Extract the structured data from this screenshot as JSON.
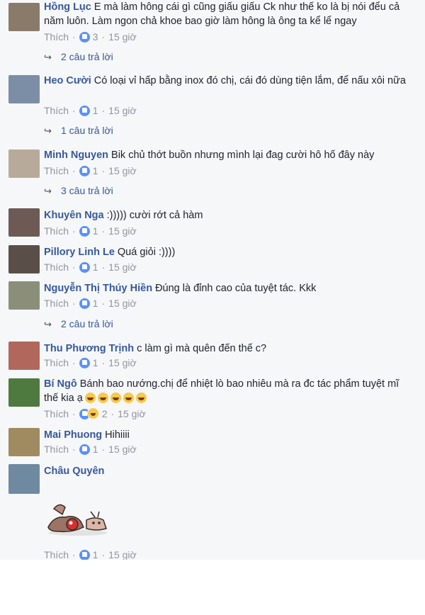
{
  "comments": [
    {
      "author": "Hồng Lục",
      "text": "E mà làm hông cái gì cũng giấu giấu Ck như thế ko là bị nói đểu cả năm luôn. Làm ngon chả khoe bao giờ làm hông là ông ta kể lể ngay",
      "like_label": "Thích",
      "count": "3",
      "time": "15 giờ",
      "replies": "2 câu trả lời",
      "avatar_color": "#8a7a6a"
    },
    {
      "author": "Heo Cười",
      "text": "Có loại vỉ hấp bằng inox đó chị, cái đó dùng tiện lắm, để nấu xôi nữa",
      "like_label": "Thích",
      "count": "1",
      "time": "15 giờ",
      "replies": "1 câu trả lời",
      "avatar_color": "#7c8da6"
    },
    {
      "author": "Minh Nguyen",
      "text": "Bik chủ thớt buồn nhưng mình lại đag cười hô hố đây này",
      "like_label": "Thích",
      "count": "1",
      "time": "15 giờ",
      "replies": "3 câu trả lời",
      "avatar_color": "#b8aa9a"
    },
    {
      "author": "Khuyên Nga",
      "text": ":))))) cười rớt cả hàm",
      "like_label": "Thích",
      "count": "1",
      "time": "15 giờ",
      "avatar_color": "#6e5a55"
    },
    {
      "author": "Pillory Linh Le",
      "text": "Quá giỏi :))))",
      "like_label": "Thích",
      "count": "1",
      "time": "15 giờ",
      "avatar_color": "#5a4f48"
    },
    {
      "author": "Nguyễn Thị Thúy Hiền",
      "text": "Đúng là đỉnh cao của tuyệt tác. Kkk",
      "like_label": "Thích",
      "count": "1",
      "time": "15 giờ",
      "replies": "2 câu trả lời",
      "avatar_color": "#8b8f7a"
    },
    {
      "author": "Thu Phương Trịnh",
      "text": "c làm gì mà quên đến thế c?",
      "like_label": "Thích",
      "count": "1",
      "time": "15 giờ",
      "avatar_color": "#b0685c"
    },
    {
      "author": "Bí Ngô",
      "text": "Bánh bao nướng.chị để nhiệt lò bao nhiêu mà ra đc tác phẩm tuyệt mĩ thế kia ạ",
      "like_label": "Thích",
      "count": "2",
      "time": "15 giờ",
      "avatar_color": "#4f7a3f"
    },
    {
      "author": "Mai Phuong",
      "text": "Hihiiii",
      "like_label": "Thích",
      "count": "1",
      "time": "15 giờ",
      "avatar_color": "#a08a60"
    },
    {
      "author": "Châu Quyên",
      "text": "",
      "like_label": "Thích",
      "count": "1",
      "time": "15 giờ",
      "avatar_color": "#6f8aa0"
    }
  ],
  "colors": {
    "author": "#365899",
    "meta": "#90949c",
    "background": "#f6f7f9"
  }
}
